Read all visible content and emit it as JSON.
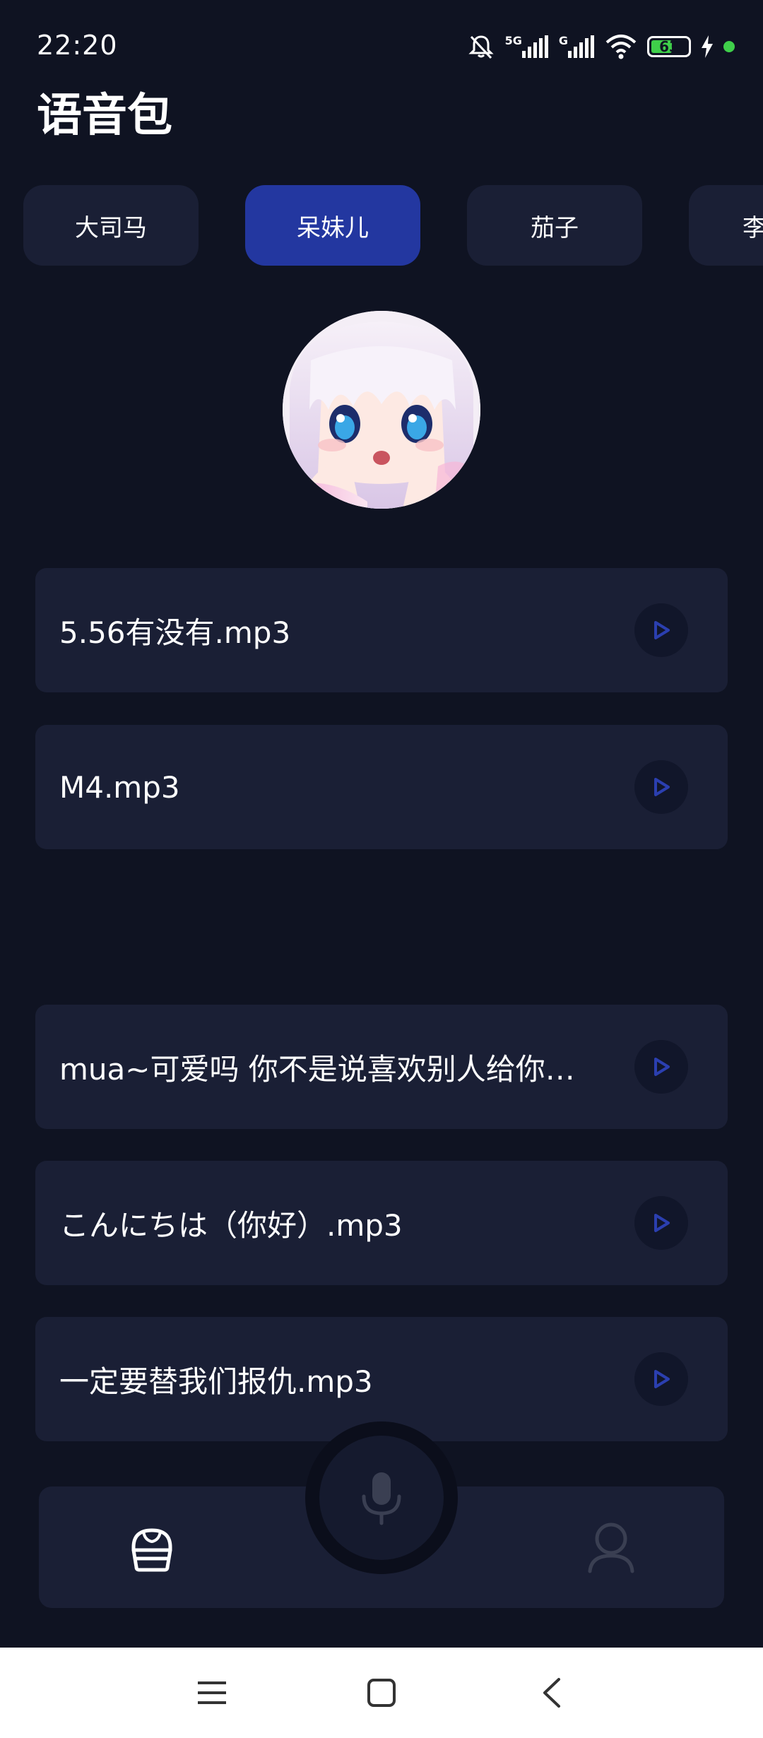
{
  "status_bar": {
    "time": "22:20",
    "network_1": "5G",
    "network_2": "G",
    "battery_level": "63",
    "battery_percent": 63,
    "icons": [
      "mute-icon",
      "signal-5g-icon",
      "signal-g-icon",
      "wifi-icon",
      "battery-icon",
      "charging-icon"
    ]
  },
  "page": {
    "title": "语音包"
  },
  "tabs": [
    {
      "label": "大司马",
      "active": false
    },
    {
      "label": "呆妹儿",
      "active": true
    },
    {
      "label": "茄子",
      "active": false
    },
    {
      "label": "李",
      "active": false
    }
  ],
  "audio_list": [
    {
      "name": "5.56有没有.mp3"
    },
    {
      "name": "M4.mp3"
    },
    {
      "name": "mua~可爱吗 你不是说喜欢别人给你…"
    },
    {
      "name": "こんにちは（你好）.mp3"
    },
    {
      "name": "一定要替我们报仇.mp3"
    }
  ],
  "bottom_nav": {
    "home_icon": "home-icon",
    "mic_icon": "microphone-icon",
    "profile_icon": "profile-icon"
  },
  "colors": {
    "background": "#0f1322",
    "card": "#1a1f35",
    "tab_active": "#2337a0",
    "play_icon": "#2b3fb0",
    "battery": "#3fcf4a"
  }
}
